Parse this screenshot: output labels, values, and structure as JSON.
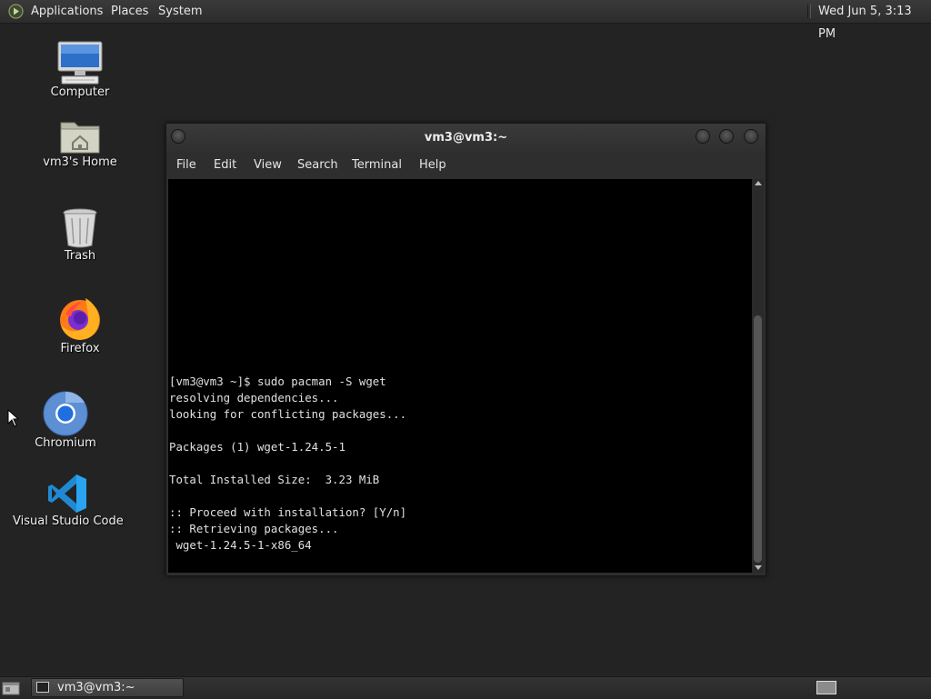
{
  "top_panel": {
    "applications": "Applications",
    "places": "Places",
    "system": "System",
    "clock": "Wed Jun  5,  3:13 PM"
  },
  "desktop_icons": [
    {
      "label": "Computer",
      "icon": "computer-icon"
    },
    {
      "label": "vm3's Home",
      "icon": "home-folder-icon"
    },
    {
      "label": "Trash",
      "icon": "trash-icon"
    },
    {
      "label": "Firefox",
      "icon": "firefox-icon"
    },
    {
      "label": "Chromium",
      "icon": "chromium-icon"
    },
    {
      "label": "Visual Studio Code",
      "icon": "vscode-icon"
    }
  ],
  "terminal": {
    "title": "vm3@vm3:~",
    "menu": [
      "File",
      "Edit",
      "View",
      "Search",
      "Terminal",
      "Help"
    ],
    "lines": [
      "[vm3@vm3 ~]$ sudo pacman -S wget",
      "resolving dependencies...",
      "looking for conflicting packages...",
      "",
      "Packages (1) wget-1.24.5-1",
      "",
      "Total Installed Size:  3.23 MiB",
      "",
      ":: Proceed with installation? [Y/n]",
      ":: Retrieving packages...",
      " wget-1.24.5-1-x86_64"
    ]
  },
  "taskbar": {
    "task_label": "vm3@vm3:~"
  },
  "colors": {
    "desktop_bg": "#232323",
    "terminal_bg": "#000000",
    "panel_bg": "#2c2c2c"
  }
}
